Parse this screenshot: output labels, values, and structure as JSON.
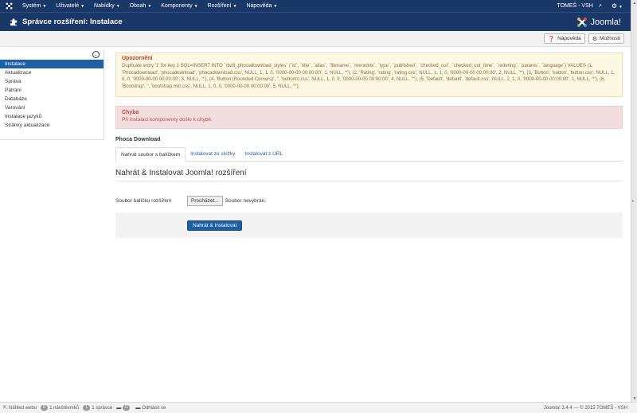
{
  "navbar": {
    "menu": [
      {
        "label": "Systém"
      },
      {
        "label": "Uživatelé"
      },
      {
        "label": "Nabídky"
      },
      {
        "label": "Obsah"
      },
      {
        "label": "Komponenty"
      },
      {
        "label": "Rozšíření"
      },
      {
        "label": "Nápověda"
      }
    ],
    "user": "TOMEŠ - VSH"
  },
  "header": {
    "title": "Správce rozšíření: Instalace",
    "brand": "Joomla!"
  },
  "toolbar": {
    "help_label": "Nápověda",
    "options_label": "Možnosti"
  },
  "sidebar": {
    "items": [
      {
        "label": "Instalace",
        "active": true
      },
      {
        "label": "Aktualizace"
      },
      {
        "label": "Správa"
      },
      {
        "label": "Pátrání"
      },
      {
        "label": "Databáze"
      },
      {
        "label": "Varování"
      },
      {
        "label": "Instalace jazyků"
      },
      {
        "label": "Stránky aktualizace"
      }
    ]
  },
  "warning": {
    "title": "Upozornění",
    "body": "Duplicate entry '1' for key 1 SQL=INSERT INTO `rbz8_phocadownload_styles` (`id`, `title`, `alias`, `filename`, `menulink`, `type`, `published`, `checked_out`, `checked_out_time`, `ordering`, `params`, `language`) VALUES (1, 'Phocadownload', 'phocadownload', 'phocadownload.css', NULL, 1, 1, 0, '0000-00-00 00:00:00', 1, NULL, '*'), (2, 'Rating', 'rating', 'rating.css', NULL, 1, 1, 0, '0000-00-00 00:00:00', 2, NULL, '*'), (3, 'Button', 'button', 'button.css', NULL, 1, 0, 0, '0000-00-00 00:00:00', 3, NULL, '*'), (4, 'Button (Rounded Corners)', '', 'buttonrc.css', NULL, 1, 0, 0, '0000-00-00 00:00:00', 4, NULL, '*'), (5, 'Default', 'default', 'default.css', NULL, 2, 1, 0, '0000-00-00 00:00:00', 1, NULL, '*'), (6, 'Bootstrap', '', 'bootstrap.min.css', NULL, 1, 0, 0, '0000-00-00 00:00:00', 5, NULL, '*');"
  },
  "error": {
    "title": "Chyba",
    "body": "Při instalaci komponenty došlo k chybě."
  },
  "component_name": "Phoca Download",
  "tabs": [
    {
      "label": "Nahrát soubor s balíčkem",
      "active": true
    },
    {
      "label": "Instalovat ze složky"
    },
    {
      "label": "Instalovat z URL"
    }
  ],
  "section_title": "Nahrát & Instalovat Joomla! rozšíření",
  "form": {
    "label": "Soubor balíčku rozšíření",
    "browse_label": "Procházet...",
    "file_status": "Soubor nevybrán.",
    "submit_label": "Nahrát & Instalovat"
  },
  "footer": {
    "view_site": "Náhled webu",
    "visitors_count": "0",
    "visitors_label": "1 návštěvníků",
    "admins_count": "1",
    "admins_label": "1 správce",
    "messages_count": "0",
    "logout": "Odhlásit se",
    "version": "Joomla! 3.4.4 — © 2015 TOMEŠ - VSH"
  }
}
